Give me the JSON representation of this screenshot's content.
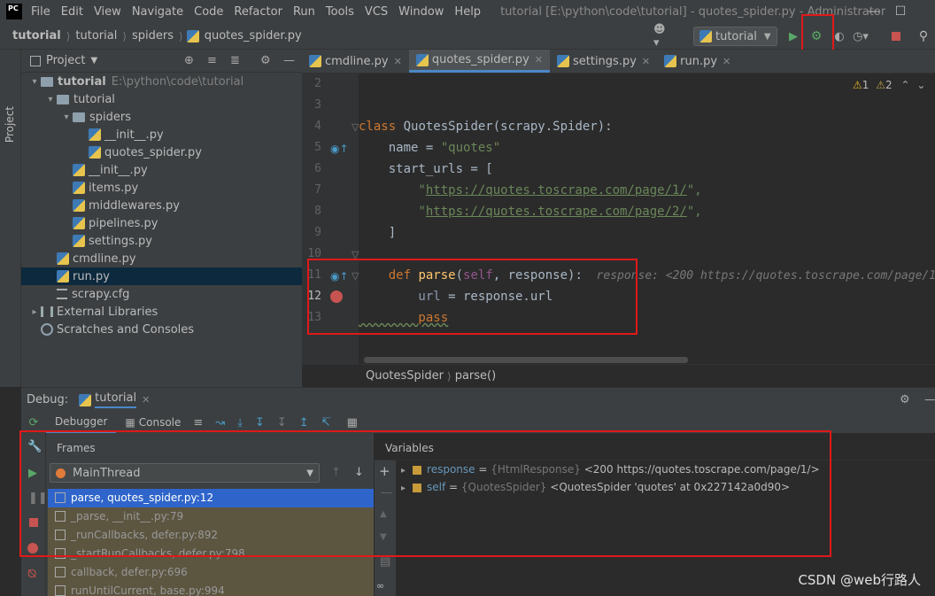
{
  "app": {
    "logo_text": "PC",
    "menu": [
      "File",
      "Edit",
      "View",
      "Navigate",
      "Code",
      "Refactor",
      "Run",
      "Tools",
      "VCS",
      "Window",
      "Help"
    ],
    "title": "tutorial [E:\\python\\code\\tutorial] - quotes_spider.py - Administrator"
  },
  "breadcrumb": [
    "tutorial",
    "tutorial",
    "spiders",
    "quotes_spider.py"
  ],
  "run_config": "tutorial",
  "project": {
    "header": "Project",
    "side_label": "Project",
    "tree": [
      {
        "label": "tutorial",
        "extra": "E:\\python\\code\\tutorial",
        "type": "folder",
        "depth": 0,
        "open": true,
        "bold": true
      },
      {
        "label": "tutorial",
        "type": "folder",
        "depth": 1,
        "open": true
      },
      {
        "label": "spiders",
        "type": "folder",
        "depth": 2,
        "open": true
      },
      {
        "label": "__init__.py",
        "type": "py",
        "depth": 3
      },
      {
        "label": "quotes_spider.py",
        "type": "py",
        "depth": 3
      },
      {
        "label": "__init__.py",
        "type": "py",
        "depth": 2
      },
      {
        "label": "items.py",
        "type": "py",
        "depth": 2
      },
      {
        "label": "middlewares.py",
        "type": "py",
        "depth": 2
      },
      {
        "label": "pipelines.py",
        "type": "py",
        "depth": 2
      },
      {
        "label": "settings.py",
        "type": "py",
        "depth": 2
      },
      {
        "label": "cmdline.py",
        "type": "py",
        "depth": 1
      },
      {
        "label": "run.py",
        "type": "py",
        "depth": 1,
        "selected": true
      },
      {
        "label": "scrapy.cfg",
        "type": "cfg",
        "depth": 1
      },
      {
        "label": "External Libraries",
        "type": "lib",
        "depth": 0,
        "closed": true
      },
      {
        "label": "Scratches and Consoles",
        "type": "scratch",
        "depth": 0
      }
    ]
  },
  "editor": {
    "tabs": [
      {
        "label": "cmdline.py",
        "active": false
      },
      {
        "label": "quotes_spider.py",
        "active": true
      },
      {
        "label": "settings.py",
        "active": false
      },
      {
        "label": "run.py",
        "active": false
      }
    ],
    "inspections": {
      "warnings": "1",
      "weak_warnings": "2"
    },
    "line_numbers": [
      "2",
      "3",
      "4",
      "5",
      "6",
      "7",
      "8",
      "9",
      "10",
      "11",
      "12",
      "13"
    ],
    "code": {
      "l4_kw": "class",
      "l4_rest": " QuotesSpider(scrapy.Spider):",
      "l5_a": "    name = ",
      "l5_str": "\"quotes\"",
      "l6": "    start_urls = [",
      "l7_q1": "        \"",
      "l7_url": "https://quotes.toscrape.com/page/1/",
      "l7_q2": "\",",
      "l8_q1": "        \"",
      "l8_url": "https://quotes.toscrape.com/page/2/",
      "l8_q2": "\",",
      "l9": "    ]",
      "l11_kw": "    def",
      "l11_fn": " parse",
      "l11_p1": "(",
      "l11_self": "self",
      "l11_p2": ", response):",
      "l11_hint": "  response: <200 https://quotes.toscrape.com/page/1/>",
      "l12_a": "        url",
      "l12_b": " = response.url",
      "l13_kw": "        pass"
    },
    "breadcrumb": [
      "QuotesSpider",
      "parse()"
    ]
  },
  "debug": {
    "label": "Debug:",
    "session": "tutorial",
    "tabs": [
      "Debugger",
      "Console"
    ],
    "frames_header": "Frames",
    "variables_header": "Variables",
    "thread": "MainThread",
    "frames": [
      {
        "label": "parse, quotes_spider.py:12",
        "selected": true
      },
      {
        "label": "_parse, __init__.py:79",
        "lib": true
      },
      {
        "label": "_runCallbacks, defer.py:892",
        "lib": true
      },
      {
        "label": "_startRunCallbacks, defer.py:798",
        "lib": true
      },
      {
        "label": "callback, defer.py:696",
        "lib": true
      },
      {
        "label": "runUntilCurrent, base.py:994",
        "lib": true
      }
    ],
    "variables": [
      {
        "name": "response",
        "type": "{HtmlResponse}",
        "value": "<200 https://quotes.toscrape.com/page/1/>"
      },
      {
        "name": "self",
        "type": "{QuotesSpider}",
        "value": "<QuotesSpider 'quotes' at 0x227142a0d90>"
      }
    ]
  },
  "watermark": "CSDN @web行路人",
  "colors": {
    "highlight_box": "#e01919",
    "selected_frame": "#2f65ca",
    "exec_line": "#2d5a8f"
  }
}
